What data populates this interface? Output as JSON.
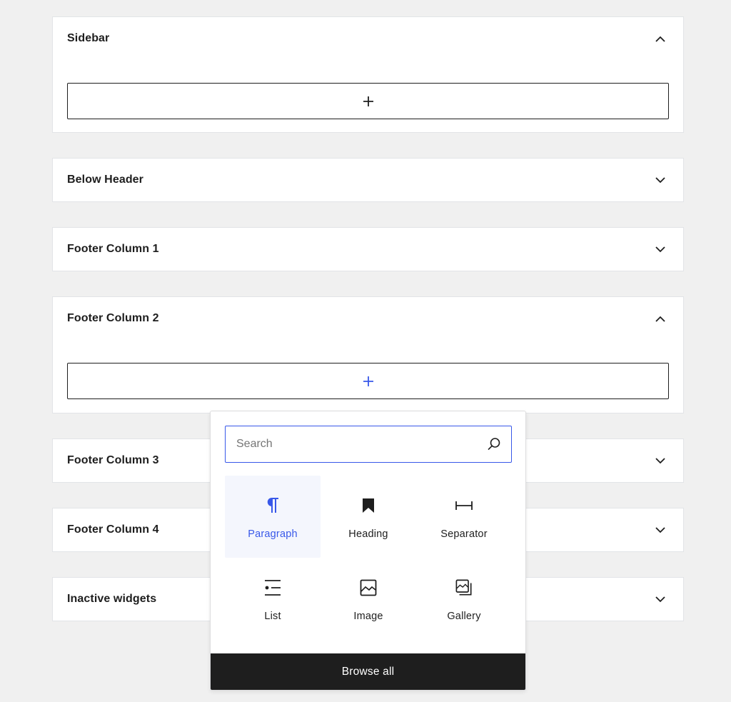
{
  "widget_areas": [
    {
      "title": "Sidebar",
      "state": "expanded"
    },
    {
      "title": "Below Header",
      "state": "collapsed"
    },
    {
      "title": "Footer Column 1",
      "state": "collapsed"
    },
    {
      "title": "Footer Column 2",
      "state": "expanded"
    },
    {
      "title": "Footer Column 3",
      "state": "collapsed"
    },
    {
      "title": "Footer Column 4",
      "state": "collapsed"
    },
    {
      "title": "Inactive widgets",
      "state": "collapsed"
    }
  ],
  "appender_icon": "plus-icon",
  "inserter": {
    "search_placeholder": "Search",
    "search_icon": "search-icon",
    "blocks": [
      {
        "label": "Paragraph",
        "icon": "paragraph-icon",
        "active": true
      },
      {
        "label": "Heading",
        "icon": "heading-icon",
        "active": false
      },
      {
        "label": "Separator",
        "icon": "separator-icon",
        "active": false
      },
      {
        "label": "List",
        "icon": "list-icon",
        "active": false
      },
      {
        "label": "Image",
        "icon": "image-icon",
        "active": false
      },
      {
        "label": "Gallery",
        "icon": "gallery-icon",
        "active": false
      }
    ],
    "browse_all_label": "Browse all"
  },
  "colors": {
    "accent": "#3858e9",
    "dark": "#1e1e1e",
    "background": "#f0f0f0"
  }
}
